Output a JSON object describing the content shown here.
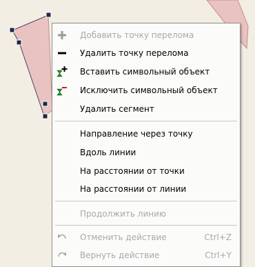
{
  "menu": {
    "items": [
      {
        "label": "Добавить точку перелома",
        "icon": "plus-icon",
        "disabled": true
      },
      {
        "label": "Удалить точку перелома",
        "icon": "minus-icon",
        "disabled": false
      },
      {
        "label": "Вставить символьный объект",
        "icon": "insert-symbol-icon",
        "disabled": false
      },
      {
        "label": "Исключить символьный объект",
        "icon": "exclude-symbol-icon",
        "disabled": false
      },
      {
        "label": "Удалить сегмент",
        "icon": "",
        "disabled": false
      },
      {
        "label": "Направление через точку",
        "icon": "",
        "disabled": false
      },
      {
        "label": "Вдоль линии",
        "icon": "",
        "disabled": false
      },
      {
        "label": "На расстоянии от точки",
        "icon": "",
        "disabled": false
      },
      {
        "label": "На расстоянии от линии",
        "icon": "",
        "disabled": false
      },
      {
        "label": "Продолжить линию",
        "icon": "",
        "disabled": true
      },
      {
        "label": "Отменить действие",
        "icon": "undo-icon",
        "shortcut": "Ctrl+Z",
        "disabled": true
      },
      {
        "label": "Вернуть действие",
        "icon": "redo-icon",
        "shortcut": "Ctrl+Y",
        "disabled": true
      }
    ]
  },
  "colors": {
    "map_background": "#f2eee4",
    "polygon_fill": "#e9c3c1",
    "polygon_stroke": "#c08f8c",
    "plus_icon_disabled": "#9a9a9a",
    "hourglass_green": "#1e8e2a",
    "insert_plus": "#000000",
    "exclude_minus": "#d81818"
  }
}
